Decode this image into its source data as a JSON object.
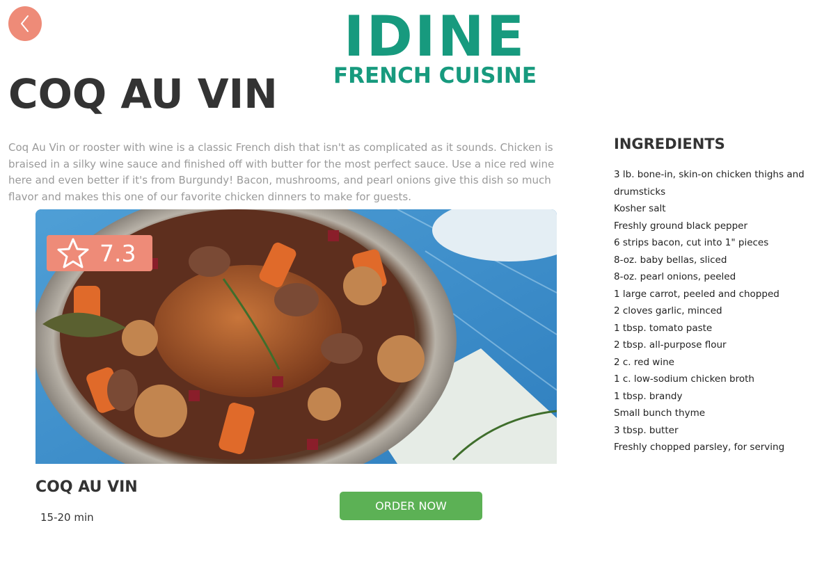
{
  "brand": {
    "name": "IDINE",
    "subtitle": "FRENCH CUISINE",
    "color": "#179a7e"
  },
  "page": {
    "title": "COQ AU VIN",
    "description": "Coq Au Vin or rooster with wine is a classic French dish that isn't as complicated as it sounds. Chicken is braised in a silky wine sauce and finished off with butter for the most perfect sauce. Use a nice red wine here and even better if it's from Burgundy! Bacon, mushrooms, and pearl onions give this dish so much flavor and makes this one of our favorite chicken dinners to make for guests."
  },
  "card": {
    "rating": "7.3",
    "title": "COQ AU VIN",
    "time": "15-20 min",
    "order_label": "ORDER NOW"
  },
  "ingredients": {
    "title": "INGREDIENTS",
    "items": [
      "3 lb. bone-in, skin-on chicken thighs and drumsticks",
      "Kosher salt",
      "Freshly ground black pepper",
      "6 strips bacon, cut into 1\" pieces",
      "8-oz. baby bellas, sliced",
      "8-oz. pearl onions, peeled",
      "1 large carrot, peeled and chopped",
      "2 cloves garlic, minced",
      "1 tbsp. tomato paste",
      "2 tbsp. all-purpose flour",
      "2 c. red wine",
      "1 c. low-sodium chicken broth",
      "1 tbsp. brandy",
      "Small bunch thyme",
      "3 tbsp. butter",
      "Freshly chopped parsley, for serving"
    ]
  },
  "icons": {
    "back": "chevron-left-icon",
    "rating": "star-outline-icon"
  },
  "colors": {
    "accent": "#ee8b78",
    "order_button": "#5cb155",
    "text": "#333333",
    "description": "#9a9a9a"
  }
}
